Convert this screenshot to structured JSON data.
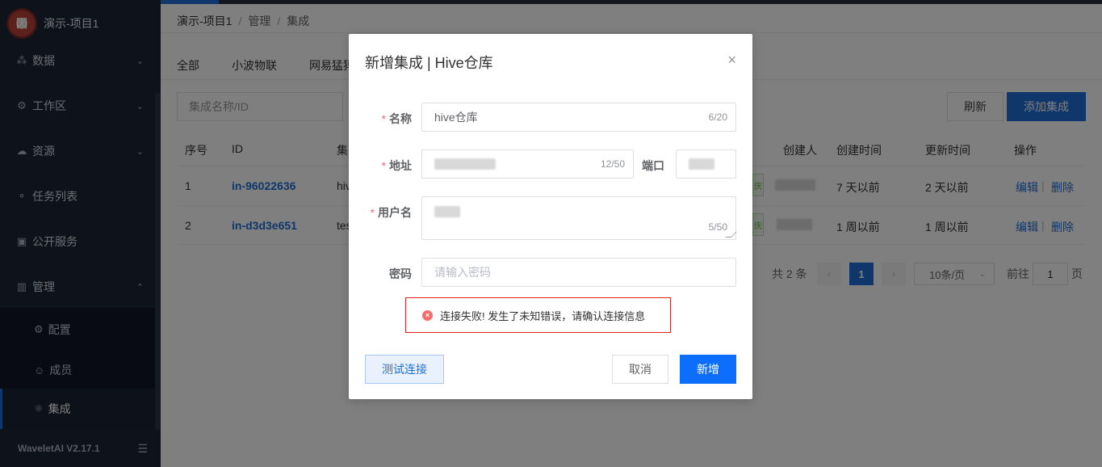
{
  "sidebar": {
    "logo_text": "図",
    "project_name": "演示-项目1",
    "items": [
      {
        "label": "数据",
        "icon": "⁂",
        "chevron": "⌄"
      },
      {
        "label": "工作区",
        "icon": "⚙",
        "chevron": "⌄"
      },
      {
        "label": "资源",
        "icon": "☁",
        "chevron": "⌄"
      },
      {
        "label": "任务列表",
        "icon": "⚬",
        "chevron": ""
      },
      {
        "label": "公开服务",
        "icon": "▣",
        "chevron": ""
      },
      {
        "label": "管理",
        "icon": "▥",
        "chevron": "⌃"
      }
    ],
    "sub_items": [
      {
        "label": "配置",
        "icon": "⚙"
      },
      {
        "label": "成员",
        "icon": "☺"
      },
      {
        "label": "集成",
        "icon": "⚛"
      }
    ],
    "version": "WaveletAI V2.17.1",
    "fold_icon": "☰"
  },
  "breadcrumb": [
    "演示-项目1",
    "管理",
    "集成"
  ],
  "breadcrumb_sep": "/",
  "tabs": [
    "全部",
    "小波物联",
    "网易猛犸"
  ],
  "search": {
    "placeholder": "集成名称/ID"
  },
  "toolbar": {
    "refresh_label": "刷新",
    "add_label": "添加集成"
  },
  "table": {
    "headers": {
      "index": "序号",
      "id": "ID",
      "name": "集",
      "creator": "创建人",
      "created": "创建时间",
      "updated": "更新时间",
      "ops": "操作"
    },
    "rows": [
      {
        "index": "1",
        "id": "in-96022636",
        "name": "hiv",
        "status": "庆",
        "created": "7 天以前",
        "updated": "2 天以前",
        "edit": "编辑",
        "delete": "删除"
      },
      {
        "index": "2",
        "id": "in-d3d3e651",
        "name": "tes",
        "status": "庆",
        "created": "1 周以前",
        "updated": "1 周以前",
        "edit": "编辑",
        "delete": "删除"
      }
    ],
    "ops_sep": "|"
  },
  "pagination": {
    "total": "共 2 条",
    "prev": "‹",
    "current": "1",
    "next": "›",
    "size": "10条/页",
    "size_arrow": "⌄",
    "goto_prefix": "前往",
    "goto_value": "1",
    "goto_suffix": "页"
  },
  "modal": {
    "title": "新增集成 | Hive仓库",
    "close": "×",
    "required_mark": "*",
    "name_label": "名称",
    "name_value": "hive仓库",
    "name_count": "6/20",
    "address_label": "地址",
    "address_count": "12/50",
    "port_label": "端口",
    "username_label": "用户名",
    "username_count": "5/50",
    "password_label": "密码",
    "password_placeholder": "请输入密码",
    "error_icon": "×",
    "error_text": "连接失败! 发生了未知错误，请确认连接信息",
    "test_label": "测试连接",
    "cancel_label": "取消",
    "create_label": "新增"
  }
}
